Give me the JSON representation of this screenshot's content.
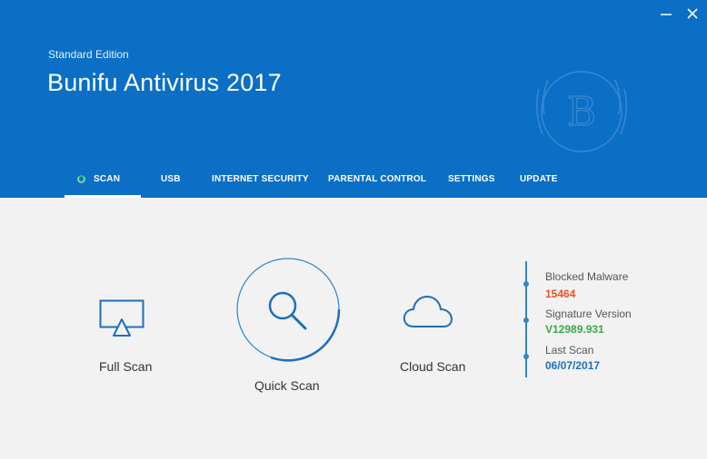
{
  "header": {
    "edition": "Standard Edition",
    "title": "Bunifu Antivirus 2017"
  },
  "tabs": [
    {
      "label": "SCAN",
      "active": true
    },
    {
      "label": "USB"
    },
    {
      "label": "INTERNET SECURITY"
    },
    {
      "label": "PARENTAL CONTROL"
    },
    {
      "label": "SETTINGS"
    },
    {
      "label": "UPDATE"
    }
  ],
  "scan_options": {
    "full": "Full Scan",
    "quick": "Quick Scan",
    "cloud": "Cloud Scan"
  },
  "stats": {
    "blocked_malware_label": "Blocked Malware",
    "blocked_malware_value": "15464",
    "signature_label": "Signature Version",
    "signature_value": "V12989.931",
    "last_scan_label": "Last Scan",
    "last_scan_value": "06/07/2017"
  },
  "colors": {
    "header": "#0b6fc6",
    "accent": "#2f86c8",
    "blocked": "#e8531e",
    "signature": "#3aa84a",
    "last_scan": "#1f6fb8"
  }
}
